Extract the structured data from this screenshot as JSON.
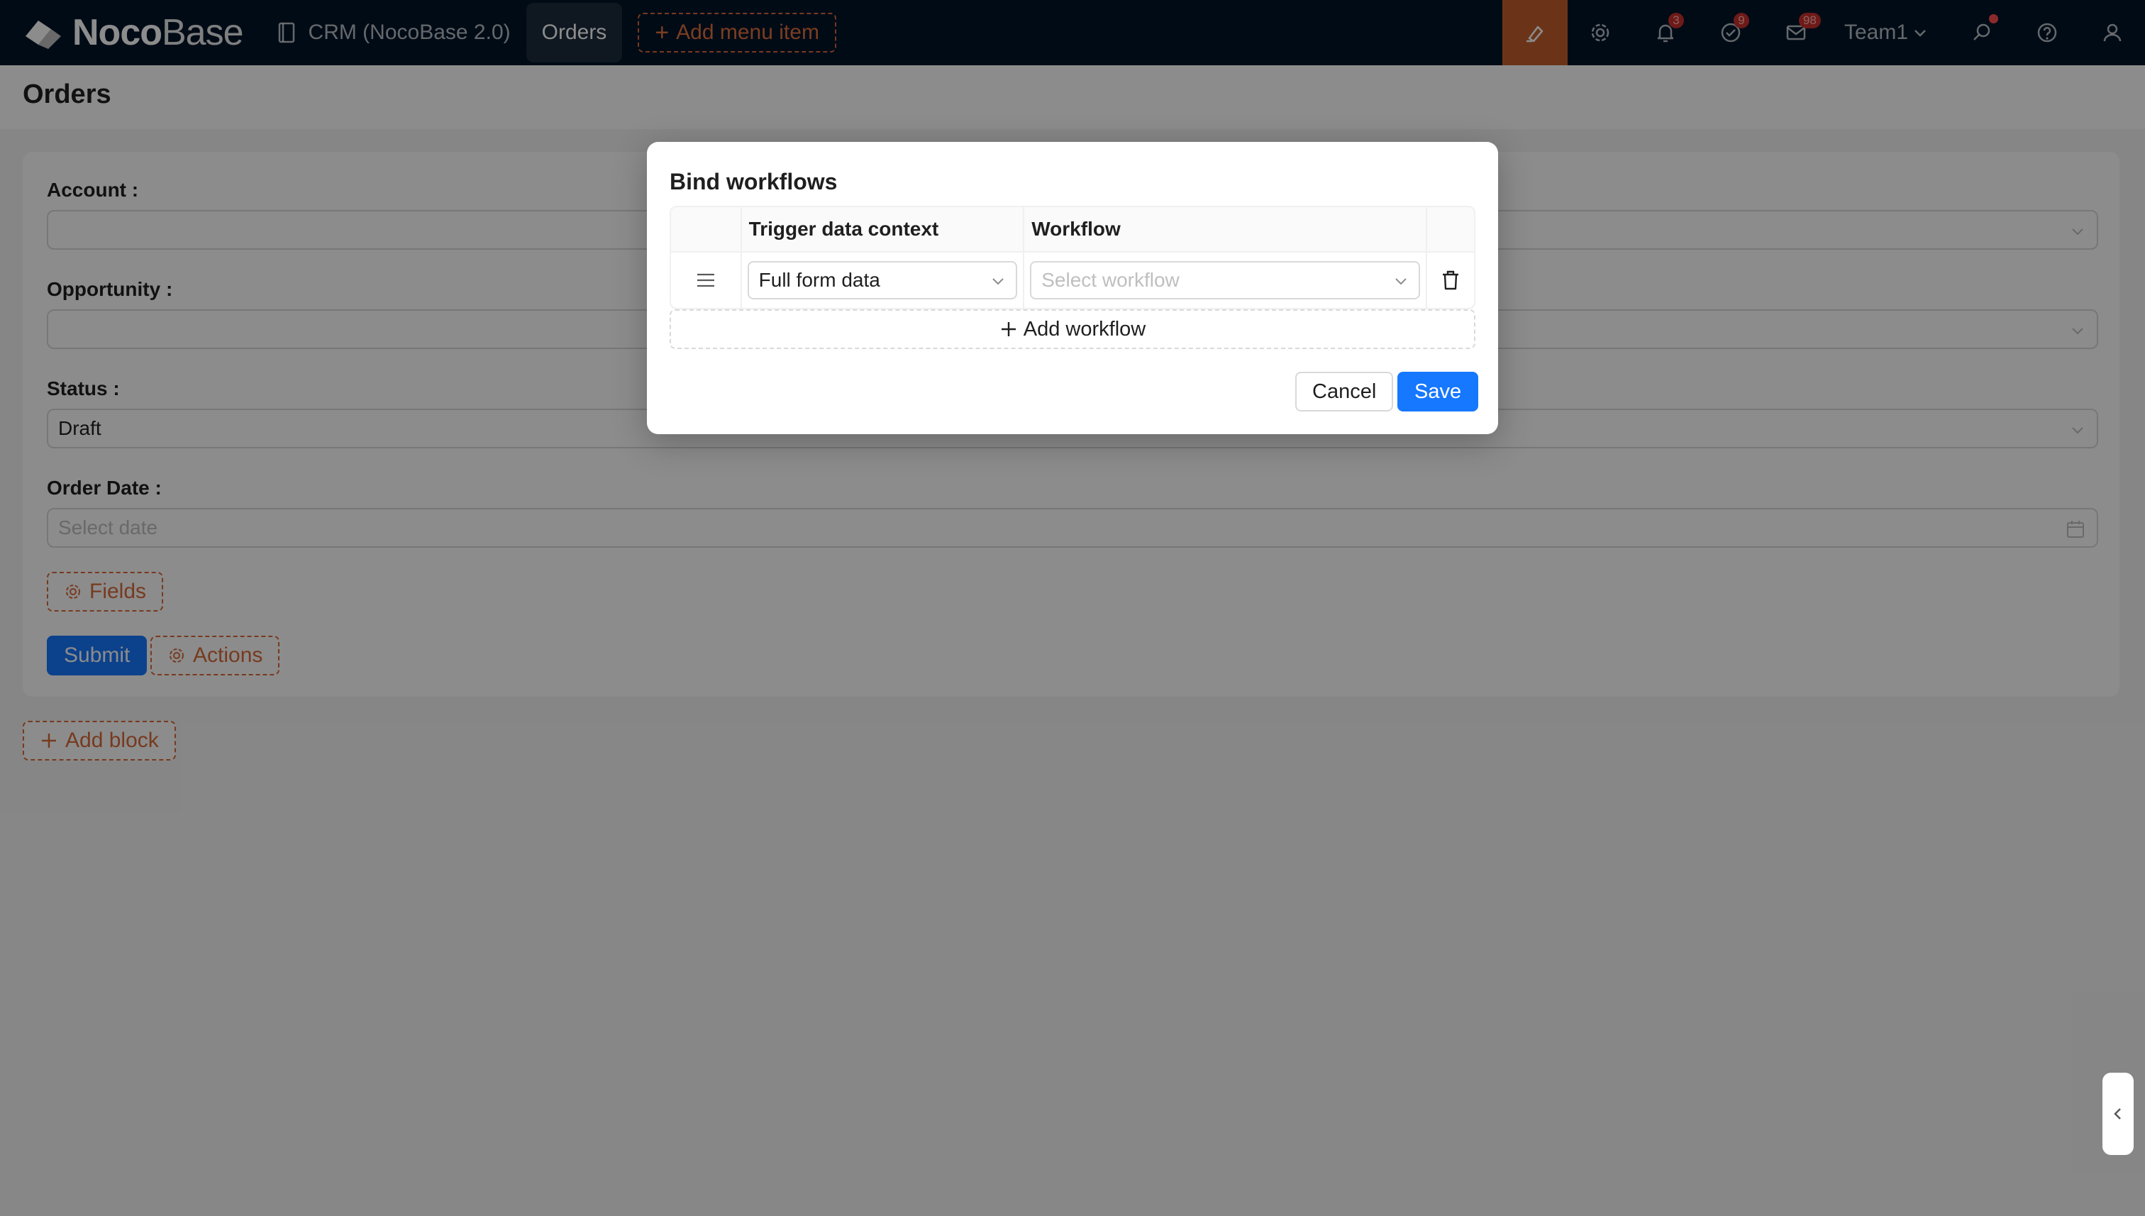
{
  "topbar": {
    "logo": {
      "bold": "Noco",
      "light": "Base"
    },
    "nav": {
      "crm": "CRM (NocoBase 2.0)",
      "orders": "Orders",
      "add_menu": "Add menu item"
    },
    "badges": {
      "notifications": "3",
      "tasks": "9",
      "messages": "98"
    },
    "team": "Team1"
  },
  "page": {
    "title": "Orders"
  },
  "form": {
    "account_label": "Account :",
    "opportunity_label": "Opportunity :",
    "status_label": "Status :",
    "status_value": "Draft",
    "order_date_label": "Order Date :",
    "order_date_placeholder": "Select date",
    "fields_btn": "Fields",
    "submit_btn": "Submit",
    "actions_btn": "Actions"
  },
  "add_block": "Add block",
  "modal": {
    "title": "Bind workflows",
    "columns": {
      "trigger": "Trigger data context",
      "workflow": "Workflow"
    },
    "rows": [
      {
        "trigger": "Full form data",
        "workflow_placeholder": "Select workflow"
      }
    ],
    "add_workflow": "Add workflow",
    "cancel": "Cancel",
    "save": "Save"
  },
  "colors": {
    "primary": "#1677ff",
    "nav_bg": "#001529",
    "accent": "#d96a3a"
  }
}
